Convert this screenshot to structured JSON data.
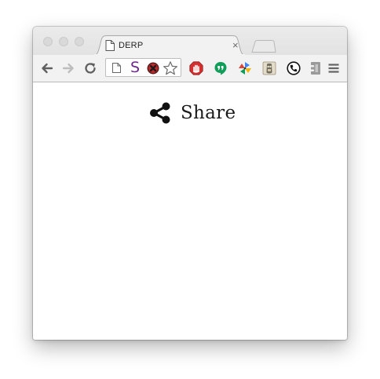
{
  "window": {
    "traffic_lights": [
      "close",
      "minimize",
      "zoom"
    ]
  },
  "tab": {
    "title": "DERP",
    "favicon": "page-icon",
    "close_label": "×"
  },
  "toolbar": {
    "back_icon": "arrow-left-icon",
    "forward_icon": "arrow-right-icon",
    "reload_icon": "reload-icon",
    "omnibox": {
      "page_icon": "page-icon",
      "s_extension_label": "S",
      "block_icon": "blocked-icon",
      "bookmark_icon": "star-icon"
    },
    "extensions": [
      {
        "name": "stop-hand-icon",
        "color": "#d32f2f"
      },
      {
        "name": "hangouts-icon",
        "color": "#0f9d58"
      },
      {
        "name": "pinwheel-icon",
        "color": "#f4b400"
      },
      {
        "name": "tabs-manager-icon",
        "color": "#c9b99a"
      },
      {
        "name": "phone-icon",
        "color": "#111111"
      },
      {
        "name": "puzzle-icon",
        "color": "#8a8a8a"
      }
    ],
    "menu_icon": "hamburger-menu-icon"
  },
  "content": {
    "share_label": "Share",
    "share_icon": "share-icon"
  },
  "colors": {
    "titlebar": "#e6e6e6",
    "toolbar": "#f2f2f2",
    "text": "#1a1a1a"
  }
}
